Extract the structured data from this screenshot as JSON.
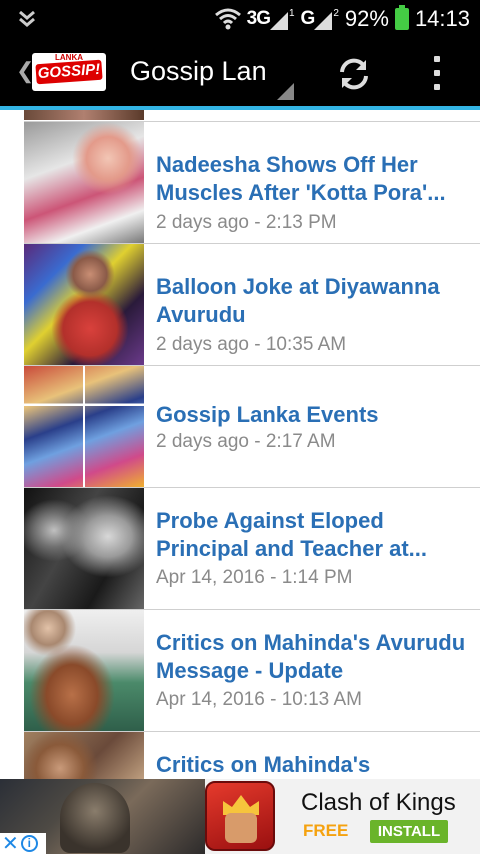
{
  "status_bar": {
    "network_1": "3G",
    "network_1_sup": "1",
    "network_2": "G",
    "network_2_sup": "2",
    "battery": "92%",
    "time": "14:13"
  },
  "action_bar": {
    "logo_top": "LANKA",
    "logo_main": "GOSSIP!",
    "title": "Gossip Lanka"
  },
  "articles": [
    {
      "headline": "Nadeesha Shows Off Her Muscles After 'Kotta Pora'...",
      "time": "2 days ago - 2:13 PM"
    },
    {
      "headline": "Balloon Joke at Diyawanna Avurudu",
      "time": "2 days ago - 10:35 AM"
    },
    {
      "headline": "Gossip Lanka Events",
      "time": "2 days ago - 2:17 AM"
    },
    {
      "headline": "Probe Against Eloped Principal and Teacher at...",
      "time": "Apr 14, 2016 - 1:14 PM"
    },
    {
      "headline": "Critics on Mahinda's Avurudu Message - Update",
      "time": "Apr 14, 2016 - 10:13 AM"
    },
    {
      "headline": "Critics on Mahinda's",
      "time": ""
    }
  ],
  "ad": {
    "app_name": "Clash of Kings",
    "price": "FREE",
    "install_label": "INSTALL"
  },
  "colors": {
    "accent": "#33b5e5",
    "headline": "#2a6fb5",
    "timestamp": "#8a8a8a"
  }
}
